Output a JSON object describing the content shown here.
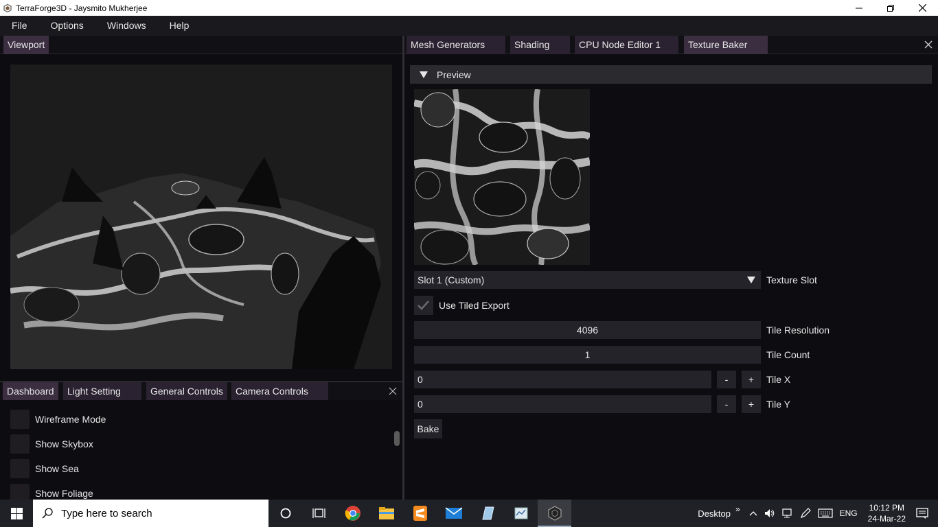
{
  "window": {
    "title": "TerraForge3D - Jaysmito Mukherjee"
  },
  "menubar": {
    "items": [
      "File",
      "Options",
      "Windows",
      "Help"
    ]
  },
  "viewport": {
    "tab_label": "Viewport"
  },
  "bottom_panel": {
    "tabs": [
      "Dashboard",
      "Light Setting",
      "General Controls",
      "Camera Controls"
    ],
    "active_tab": "Dashboard",
    "checkboxes": [
      {
        "label": "Wireframe Mode",
        "checked": false
      },
      {
        "label": "Show Skybox",
        "checked": false
      },
      {
        "label": "Show Sea",
        "checked": false
      },
      {
        "label": "Show Foliage",
        "checked": false
      }
    ]
  },
  "right_panel": {
    "tabs": [
      "Mesh Generators",
      "Shading",
      "CPU Node Editor 1",
      "Texture Baker"
    ],
    "active_tab": "Texture Baker",
    "preview_header": "Preview",
    "texture_slot": {
      "value": "Slot 1 (Custom)",
      "label": "Texture Slot"
    },
    "use_tiled_export": {
      "label": "Use Tiled Export",
      "checked": true
    },
    "tile_resolution": {
      "value": "4096",
      "label": "Tile Resolution"
    },
    "tile_count": {
      "value": "1",
      "label": "Tile Count"
    },
    "tile_x": {
      "value": "0",
      "label": "Tile X",
      "minus": "-",
      "plus": "+"
    },
    "tile_y": {
      "value": "0",
      "label": "Tile Y",
      "minus": "-",
      "plus": "+"
    },
    "bake_button": "Bake"
  },
  "taskbar": {
    "search_placeholder": "Type here to search",
    "desktop_label": "Desktop",
    "chevron": "»",
    "language": "ENG",
    "time": "10:12 PM",
    "date": "24-Mar-22",
    "pinned_apps": [
      "cortana-icon",
      "task-view-icon",
      "chrome-icon",
      "file-explorer-icon",
      "sublime-text-icon",
      "mail-icon",
      "app-blue-icon",
      "app-notepad-icon",
      "terraforge-icon"
    ]
  }
}
